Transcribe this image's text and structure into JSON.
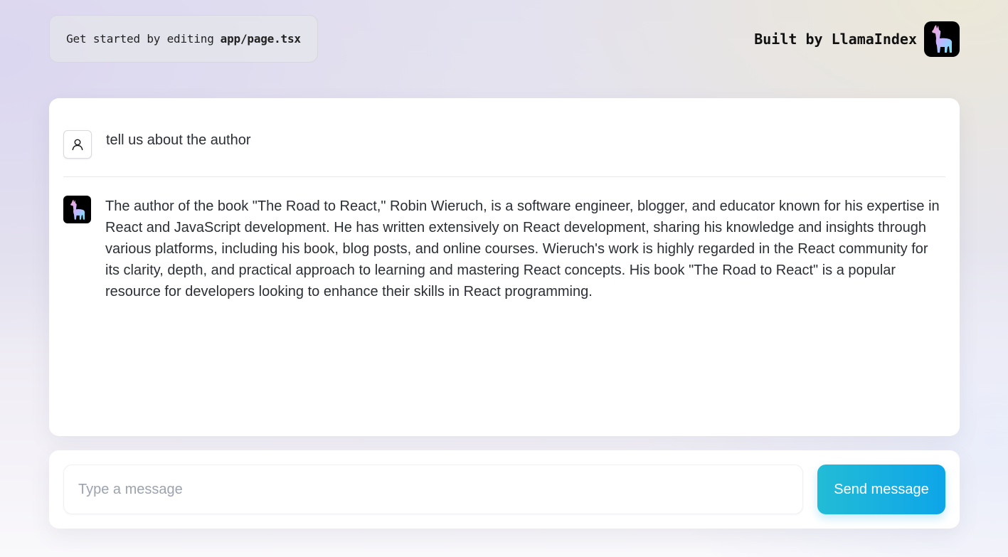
{
  "header": {
    "hint_prefix": "Get started by editing",
    "hint_file": "app/page.tsx",
    "brand_text": "Built by LlamaIndex",
    "brand_logo_icon": "llama-icon"
  },
  "messages": [
    {
      "role": "user",
      "avatar_icon": "user-icon",
      "text": "tell us about the author"
    },
    {
      "role": "assistant",
      "avatar_icon": "llama-icon",
      "text": "The author of the book \"The Road to React,\" Robin Wieruch, is a software engineer, blogger, and educator known for his expertise in React and JavaScript development. He has written extensively on React development, sharing his knowledge and insights through various platforms, including his book, blog posts, and online courses. Wieruch's work is highly regarded in the React community for its clarity, depth, and practical approach to learning and mastering React concepts. His book \"The Road to React\" is a popular resource for developers looking to enhance their skills in React programming."
    }
  ],
  "composer": {
    "placeholder": "Type a message",
    "value": "",
    "send_label": "Send message"
  },
  "colors": {
    "accent_start": "#22bcd6",
    "accent_end": "#0ea5e9",
    "llama_pink": "#f472b6",
    "llama_cyan": "#67e8f9"
  }
}
